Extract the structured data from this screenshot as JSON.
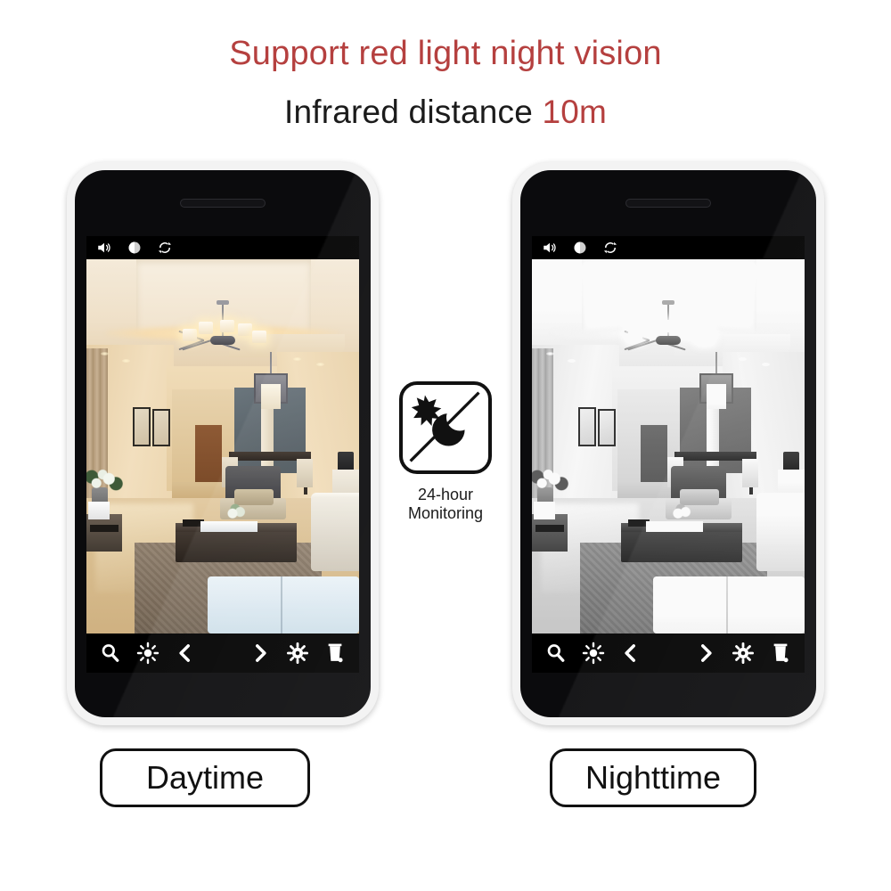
{
  "headline": "Support red light night vision",
  "subline": {
    "text": "Infrared distance ",
    "accent": "10m"
  },
  "colors": {
    "accent_red": "#b5403f",
    "text_dark": "#1b1b1b",
    "phone_bezel": "#f3f3f3",
    "phone_body": "#0b0b0d",
    "toolbar_bg": "#000000"
  },
  "badge": {
    "icon_sun": "sun-icon",
    "icon_moon": "moon-icon",
    "divider": "diagonal-divider",
    "caption_line1": "24-hour",
    "caption_line2": "Monitoring"
  },
  "phones": [
    {
      "id": "daytime",
      "label": "Daytime",
      "mode": "day",
      "appbar_icons": [
        "speaker-icon",
        "contrast-icon",
        "refresh-icon"
      ],
      "toolbar_icons_left": [
        "search-icon",
        "brightness-icon",
        "previous-icon"
      ],
      "toolbar_icons_right": [
        "next-icon",
        "settings-gear-icon",
        "delete-trash-icon"
      ]
    },
    {
      "id": "nighttime",
      "label": "Nighttime",
      "mode": "night",
      "appbar_icons": [
        "speaker-icon",
        "contrast-icon",
        "refresh-icon"
      ],
      "toolbar_icons_left": [
        "search-icon",
        "brightness-icon",
        "previous-icon"
      ],
      "toolbar_icons_right": [
        "next-icon",
        "settings-gear-icon",
        "delete-trash-icon"
      ]
    }
  ]
}
